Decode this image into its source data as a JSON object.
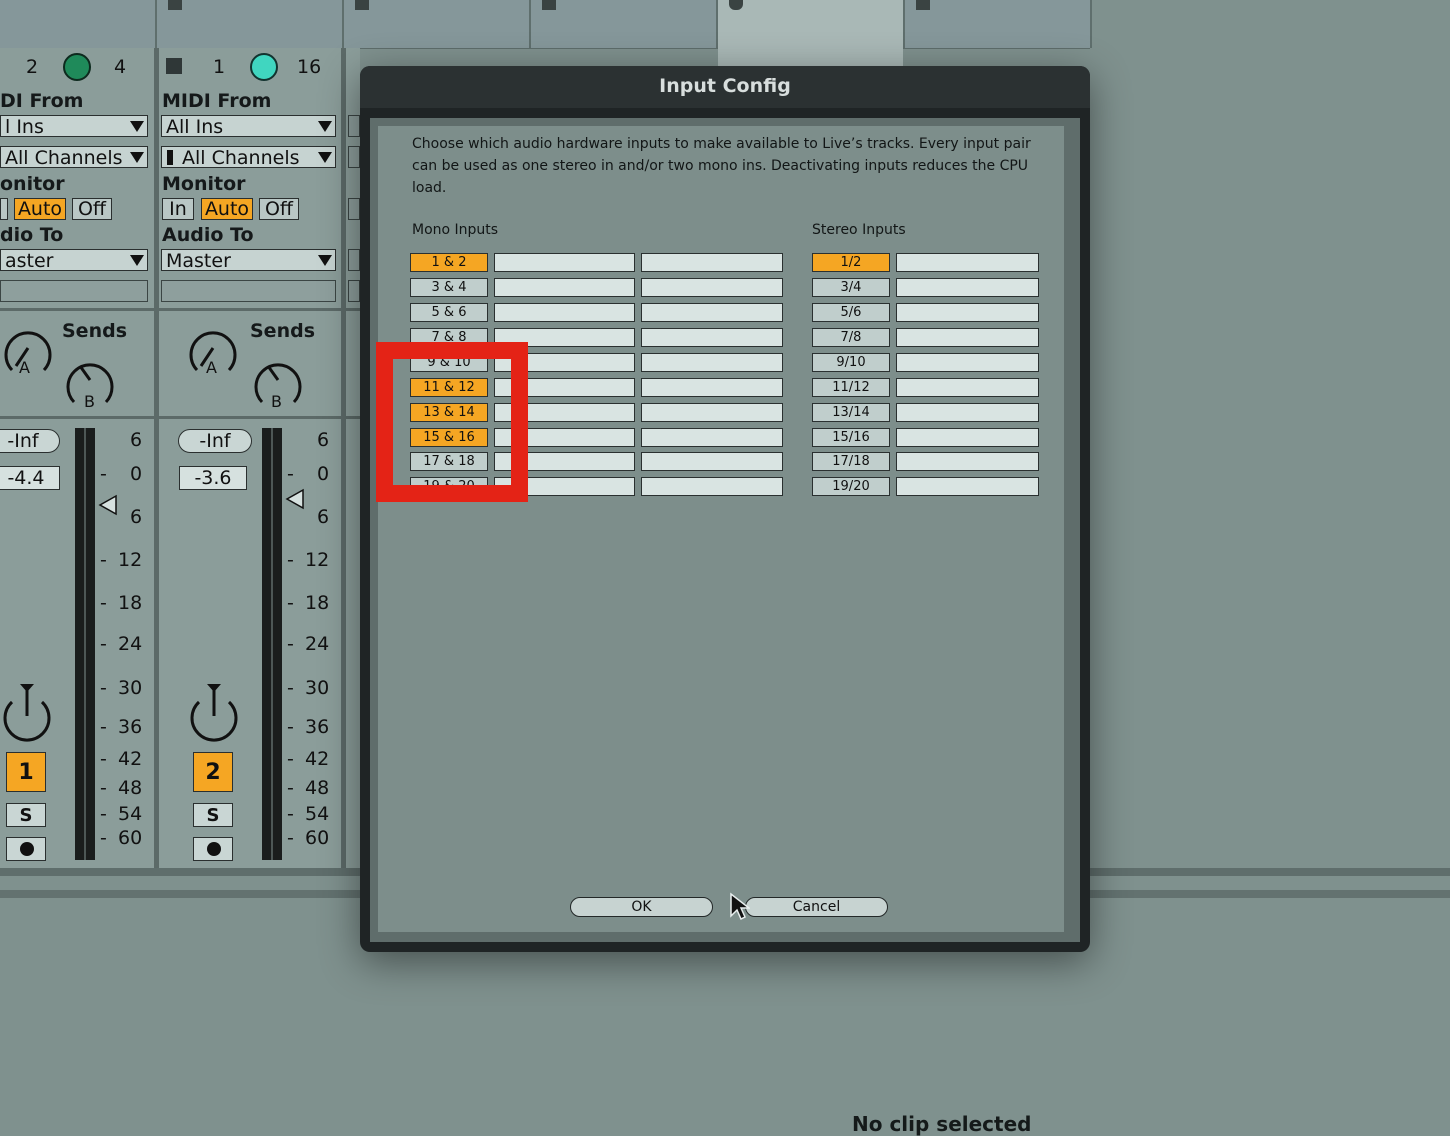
{
  "tracks": [
    {
      "io_counts": [
        "2",
        "4"
      ],
      "midi_from_label": "DI From",
      "midi_from_value": "l Ins",
      "channel_value": "All Channels",
      "monitor_label": "onitor",
      "monitor_options": [
        "",
        "Auto",
        "Off"
      ],
      "audio_to_label": "dio To",
      "audio_to_value": "aster",
      "sends_label": "Sends",
      "send_a": "A",
      "send_b": "B",
      "inf_label": "-Inf",
      "volume": "-4.4",
      "track_number": "1",
      "solo": "S"
    },
    {
      "io_counts": [
        "1",
        "16"
      ],
      "midi_from_label": "MIDI From",
      "midi_from_value": "All Ins",
      "channel_value": "All Channels",
      "monitor_label": "Monitor",
      "monitor_options": [
        "In",
        "Auto",
        "Off"
      ],
      "audio_to_label": "Audio To",
      "audio_to_value": "Master",
      "sends_label": "Sends",
      "send_a": "A",
      "send_b": "B",
      "inf_label": "-Inf",
      "volume": "-3.6",
      "track_number": "2",
      "solo": "S"
    }
  ],
  "meter_scale": [
    "6",
    "0",
    "6",
    "12",
    "18",
    "24",
    "30",
    "36",
    "42",
    "48",
    "54",
    "60"
  ],
  "dialog": {
    "title": "Input Config",
    "description": "Choose which audio hardware inputs to make available to Live’s tracks. Every input pair can be used as one stereo in and/or two mono ins.  Deactivating inputs reduces the CPU load.",
    "mono_label": "Mono Inputs",
    "stereo_label": "Stereo Inputs",
    "mono_inputs": [
      {
        "label": "1 & 2",
        "active": true
      },
      {
        "label": "3 & 4",
        "active": false
      },
      {
        "label": "5 & 6",
        "active": false
      },
      {
        "label": "7 & 8",
        "active": false
      },
      {
        "label": "9 & 10",
        "active": false
      },
      {
        "label": "11 & 12",
        "active": true
      },
      {
        "label": "13 & 14",
        "active": true
      },
      {
        "label": "15 & 16",
        "active": true
      },
      {
        "label": "17 & 18",
        "active": false
      },
      {
        "label": "19 & 20",
        "active": false
      }
    ],
    "stereo_inputs": [
      {
        "label": "1/2",
        "active": true
      },
      {
        "label": "3/4",
        "active": false
      },
      {
        "label": "5/6",
        "active": false
      },
      {
        "label": "7/8",
        "active": false
      },
      {
        "label": "9/10",
        "active": false
      },
      {
        "label": "11/12",
        "active": false
      },
      {
        "label": "13/14",
        "active": false
      },
      {
        "label": "15/16",
        "active": false
      },
      {
        "label": "17/18",
        "active": false
      },
      {
        "label": "19/20",
        "active": false
      }
    ],
    "ok_label": "OK",
    "cancel_label": "Cancel"
  },
  "status": {
    "no_clip": "No clip selected"
  },
  "colors": {
    "active": "#f5a623",
    "highlight": "#e42316",
    "knob_green": "#1f8a5a",
    "knob_teal": "#40d6c0"
  }
}
